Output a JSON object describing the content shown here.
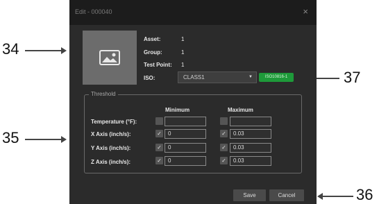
{
  "dialog": {
    "title": "Edit - 000040",
    "close_symbol": "×"
  },
  "asset_info": {
    "asset_label": "Asset:",
    "asset_value": "1",
    "group_label": "Group:",
    "group_value": "1",
    "test_point_label": "Test Point:",
    "test_point_value": "1",
    "iso_label": "ISO:",
    "iso_selected": "CLASS1",
    "iso_badge": "ISO10816-1"
  },
  "threshold": {
    "legend": "Threshold",
    "min_header": "Minimum",
    "max_header": "Maximum",
    "rows": [
      {
        "label": "Temperature  (°F):",
        "min_checked": false,
        "min_value": "",
        "max_checked": false,
        "max_value": ""
      },
      {
        "label": "X Axis  (inch/s):",
        "min_checked": true,
        "min_value": "0",
        "max_checked": true,
        "max_value": "0.03"
      },
      {
        "label": "Y Axis  (inch/s):",
        "min_checked": true,
        "min_value": "0",
        "max_checked": true,
        "max_value": "0.03"
      },
      {
        "label": "Z Axis  (inch/s):",
        "min_checked": true,
        "min_value": "0",
        "max_checked": true,
        "max_value": "0.03"
      }
    ]
  },
  "buttons": {
    "save": "Save",
    "cancel": "Cancel"
  },
  "callouts": {
    "c34": "34",
    "c35": "35",
    "c36": "36",
    "c37": "37"
  },
  "icons": {
    "image_placeholder": "image-placeholder-icon",
    "checkmark": "✓"
  },
  "colors": {
    "dialog_bg": "#2b2b2b",
    "titlebar_bg": "#1c1c1c",
    "iso_badge_bg": "#1e9a3a",
    "button_bg": "#4a4a4a"
  }
}
